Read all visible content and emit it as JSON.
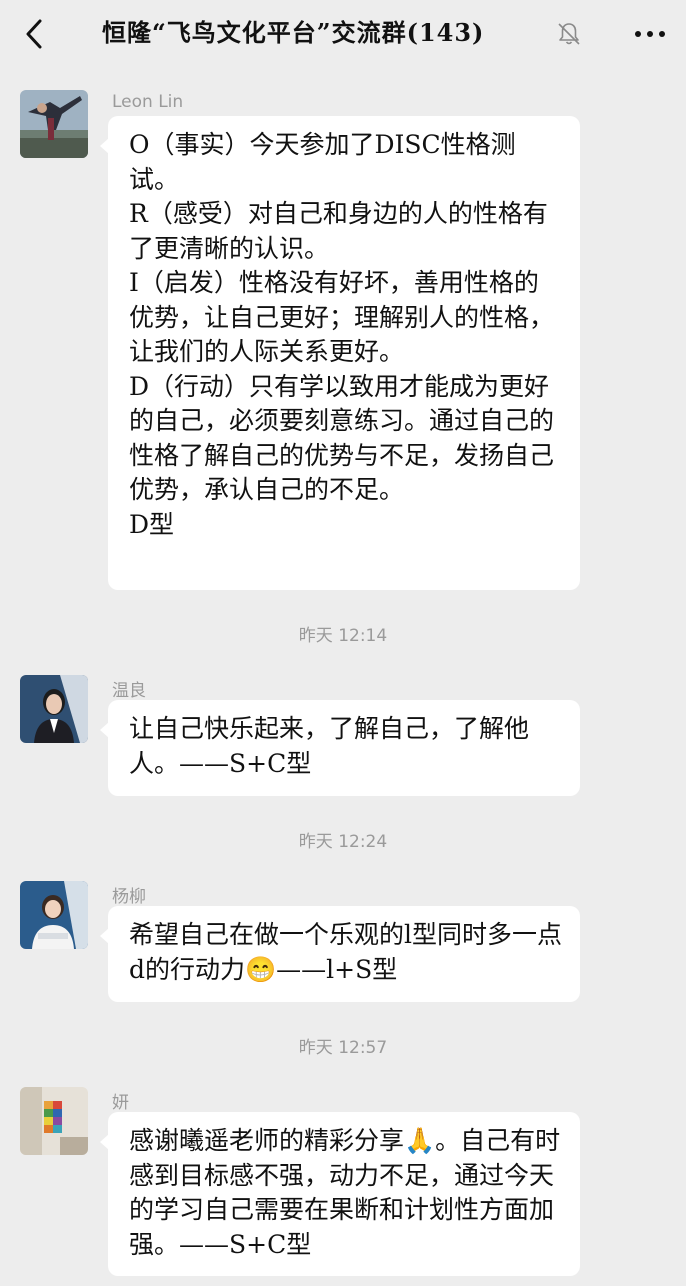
{
  "header": {
    "back_icon": "back-chevron-icon",
    "title": "恒隆“飞鸟文化平台”交流群(143)",
    "mute_icon": "bell-muted-icon",
    "more_icon": "more-dots-icon"
  },
  "messages": [
    {
      "sender": "Leon Lin",
      "text": "O（事实）今天参加了DISC性格测试。\nR（感受）对自己和身边的人的性格有了更清晰的认识。\nI（启发）性格没有好坏，善用性格的优势，让自己更好；理解别人的性格，让我们的人际关系更好。\nD（行动）只有学以致用才能成为更好的自己，必须要刻意练习。通过自己的性格了解自己的优势与不足，发扬自己优势，承认自己的不足。\nD型"
    },
    {
      "sender": "温良",
      "text": "让自己快乐起来，了解自己，了解他人。——S+C型"
    },
    {
      "sender": "杨柳",
      "text": "希望自己在做一个乐观的l型同时多一点d的行动力😁——l+S型"
    },
    {
      "sender": "妍",
      "text": "感谢曦遥老师的精彩分享🙏。自己有时感到目标感不强，动力不足，通过今天的学习自己需要在果断和计划性方面加强。——S+C型"
    }
  ],
  "timestamps": [
    "昨天 12:14",
    "昨天 12:24",
    "昨天 12:57"
  ],
  "colors": {
    "background": "#ededed",
    "bubble": "#ffffff",
    "meta_text": "#9a9a9a",
    "text": "#111111"
  }
}
